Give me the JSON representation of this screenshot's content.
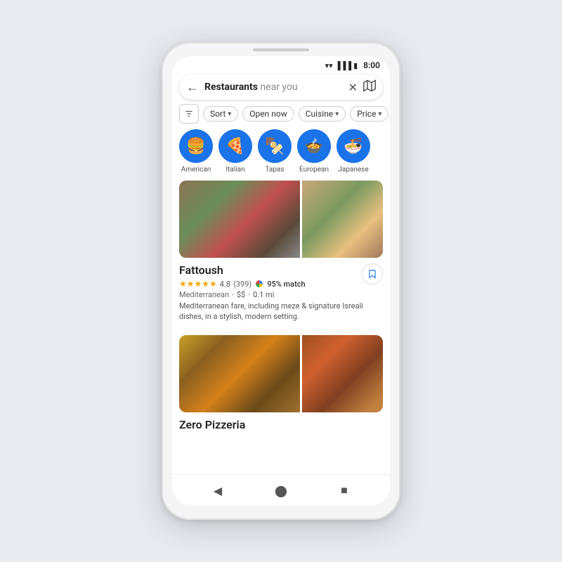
{
  "phone": {
    "status_bar": {
      "time": "8:00",
      "icons": [
        "wifi",
        "signal",
        "battery"
      ]
    },
    "search": {
      "query": "Restaurants",
      "query_suffix": " near you",
      "back_icon": "←",
      "clear_icon": "✕",
      "map_icon": "⊞"
    },
    "filters": {
      "filter_icon_label": "⊟",
      "chips": [
        {
          "label": "Sort",
          "has_arrow": true
        },
        {
          "label": "Open now",
          "has_arrow": false
        },
        {
          "label": "Cuisine",
          "has_arrow": true
        },
        {
          "label": "Price",
          "has_arrow": true
        }
      ]
    },
    "cuisines": [
      {
        "icon": "🍔",
        "label": "American"
      },
      {
        "icon": "🍕",
        "label": "Italian"
      },
      {
        "icon": "🍢",
        "label": "Tapas"
      },
      {
        "icon": "🍲",
        "label": "European"
      },
      {
        "icon": "🍜",
        "label": "Japanese"
      }
    ],
    "restaurants": [
      {
        "name": "Fattoush",
        "rating": "4.8",
        "stars": "★★★★★",
        "review_count": "(399)",
        "match": "95% match",
        "type": "Mediterranean",
        "price": "$$",
        "distance": "0.1 mi",
        "description": "Mediterranean fare, including meze & signature Isreali dishes, in a stylish, modern setting.",
        "img_main_class": "food-fattoush-main",
        "img_side_class": "food-fattoush-side"
      },
      {
        "name": "Zero Pizzeria",
        "rating": "",
        "stars": "",
        "review_count": "",
        "match": "",
        "type": "",
        "price": "",
        "distance": "",
        "description": "",
        "img_main_class": "food-pizza-main",
        "img_side_class": "food-pizza-side"
      }
    ],
    "nav": {
      "back_icon": "◀",
      "home_icon": "⬤",
      "square_icon": "■"
    }
  }
}
